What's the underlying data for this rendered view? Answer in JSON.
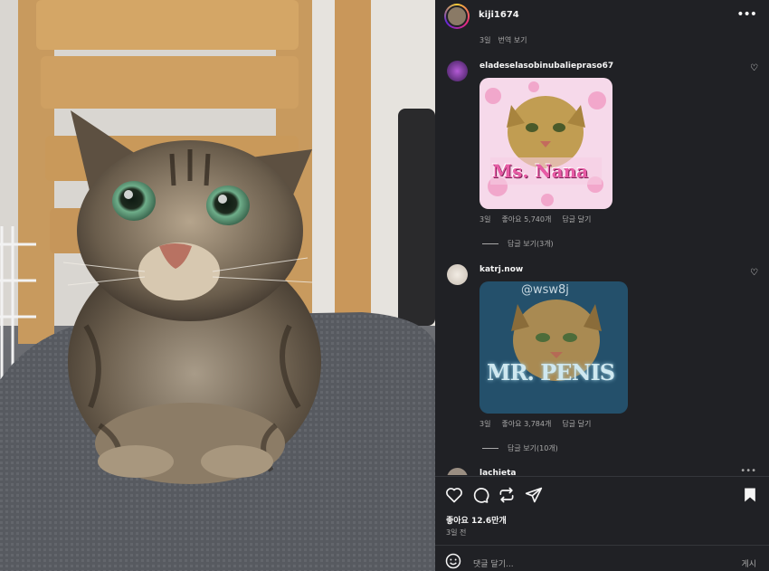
{
  "post": {
    "username": "kiji1674",
    "icons": {
      "more": "more-options-icon"
    }
  },
  "previous_comment_meta": {
    "time": "3일",
    "translate": "번역 보기"
  },
  "comments": [
    {
      "username": "eladeselasobinubaliepraso67",
      "image_caption": "Ms. Nana",
      "time": "3일",
      "likes": "좋아요 5,740개",
      "reply": "답글 달기",
      "view_replies": "답글 보기(3개)"
    },
    {
      "username": "katrj.now",
      "image_caption": "MR. PENIS",
      "image_watermark": "@wsw8j",
      "time": "3일",
      "likes": "좋아요 3,784개",
      "reply": "답글 달기",
      "view_replies": "답글 보기(10개)"
    },
    {
      "username": "lachieta"
    }
  ],
  "footer": {
    "likes": "좋아요 12.6만개",
    "time": "3일 전",
    "comment_placeholder": "댓글 달기...",
    "post_button": "게시",
    "icons": [
      "heart-icon",
      "comment-icon",
      "share-icon",
      "send-icon",
      "bookmark-icon"
    ]
  },
  "colors": {
    "panel_bg": "#202125",
    "text": "#f5f5f5",
    "muted": "#a8a8a8"
  }
}
